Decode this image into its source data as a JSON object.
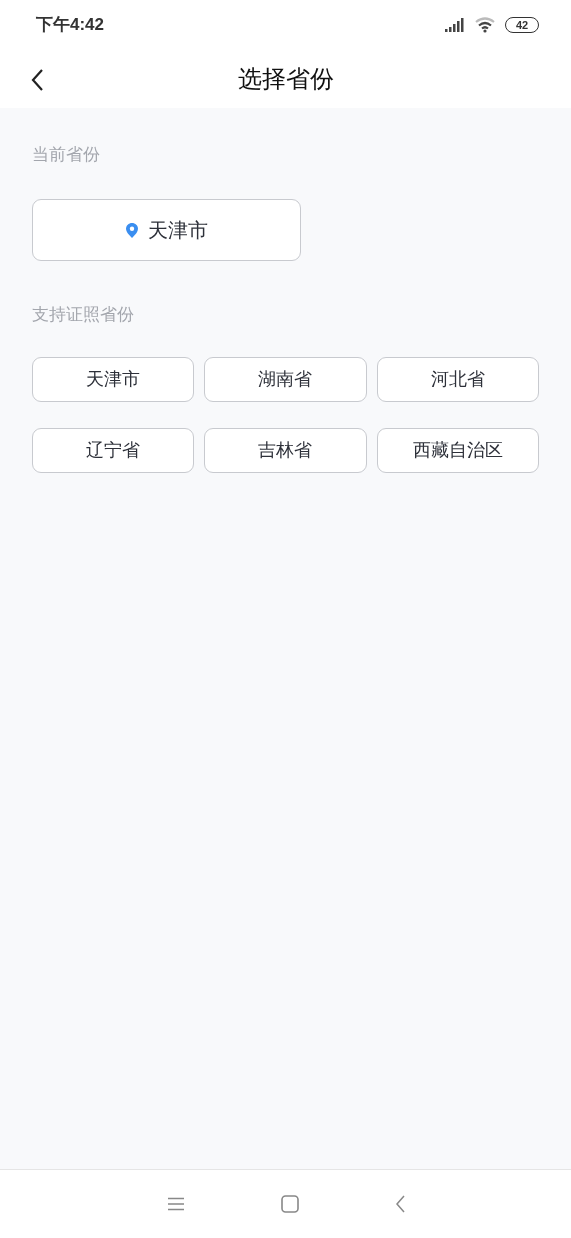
{
  "status_bar": {
    "time": "下午4:42",
    "battery": "42"
  },
  "header": {
    "title": "选择省份"
  },
  "current": {
    "label": "当前省份",
    "province": "天津市"
  },
  "supported": {
    "label": "支持证照省份",
    "provinces": [
      "天津市",
      "湖南省",
      "河北省",
      "辽宁省",
      "吉林省",
      "西藏自治区"
    ]
  }
}
